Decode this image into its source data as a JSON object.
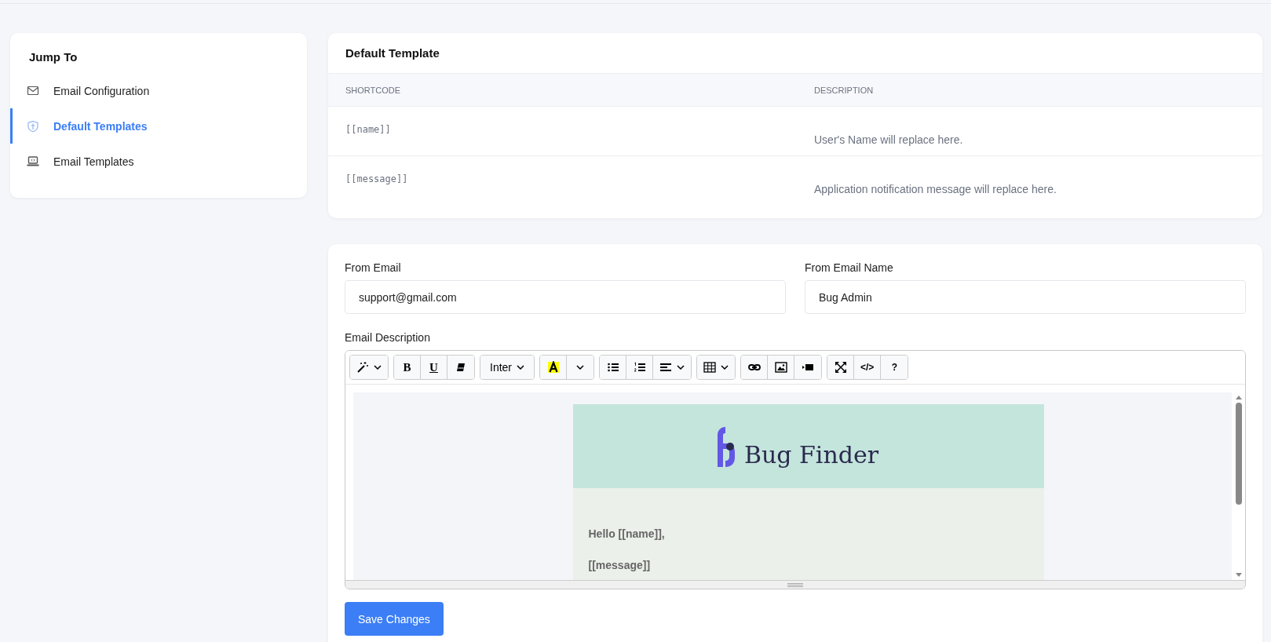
{
  "sidebar": {
    "title": "Jump To",
    "items": [
      {
        "label": "Email Configuration",
        "selected": false
      },
      {
        "label": "Default Templates",
        "selected": true
      },
      {
        "label": "Email Templates",
        "selected": false
      }
    ]
  },
  "shortcodes": {
    "title": "Default Template",
    "columns": [
      "SHORTCODE",
      "DESCRIPTION"
    ],
    "rows": [
      {
        "shortcode": "[[name]]",
        "description": "User's Name will replace here."
      },
      {
        "shortcode": "[[message]]",
        "description": "Application notification message will replace here."
      }
    ]
  },
  "form": {
    "fields": [
      {
        "label": "From Email",
        "value": "support@gmail.com"
      },
      {
        "label": "From Email Name",
        "value": "Bug Admin"
      }
    ],
    "editor_label": "Email Description",
    "toolbar": [
      [
        {
          "kind": "icon",
          "caret": true
        }
      ],
      [
        {
          "kind": "text",
          "label": "B"
        },
        {
          "kind": "text",
          "label": "U"
        },
        {
          "kind": "icon"
        }
      ],
      [
        {
          "kind": "text",
          "label": "Inter",
          "caret": true
        }
      ],
      [
        {
          "kind": "icon"
        },
        {
          "kind": "icon",
          "caret": true
        }
      ],
      [
        {
          "kind": "icon"
        },
        {
          "kind": "icon"
        },
        {
          "kind": "icon",
          "caret": true
        }
      ],
      [
        {
          "kind": "icon",
          "caret": true
        }
      ],
      [
        {
          "kind": "icon"
        },
        {
          "kind": "icon"
        },
        {
          "kind": "icon"
        }
      ],
      [
        {
          "kind": "icon"
        },
        {
          "kind": "text",
          "label": "</>"
        },
        {
          "kind": "text",
          "label": "?"
        }
      ]
    ],
    "email": {
      "brand": "Bug Finder",
      "lines": [
        "Hello [[name]],",
        "[[message]]"
      ]
    },
    "save_button": "Save Changes"
  }
}
